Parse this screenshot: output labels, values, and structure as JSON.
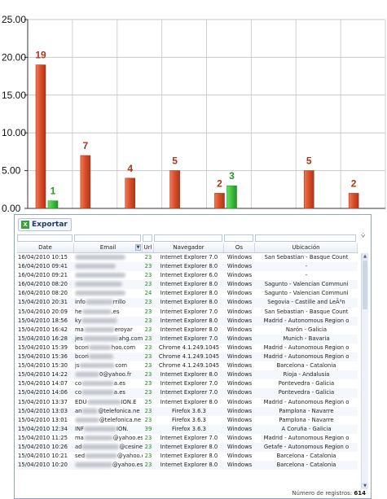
{
  "chart_data": {
    "type": "bar",
    "categories": [
      "",
      "",
      "",
      "",
      "",
      "",
      "",
      ""
    ],
    "series": [
      {
        "color": "#d84d2a",
        "values": [
          19,
          7,
          4,
          5,
          2,
          null,
          5,
          2
        ]
      },
      {
        "color": "#3cbf3c",
        "values": [
          1,
          null,
          null,
          null,
          3,
          null,
          null,
          null
        ]
      }
    ],
    "ylim": [
      0,
      25
    ],
    "ytick_labels": [
      "0.00",
      "5.00",
      "10.00",
      "15.00",
      "20.00",
      "25.00"
    ],
    "grid": true,
    "data_labels": true
  },
  "toolbar": {
    "export_label": "Exportar",
    "export_icon": "excel-icon"
  },
  "table": {
    "columns": [
      "Date",
      "Email",
      "Url",
      "Navegador",
      "Os",
      "Ubicación"
    ],
    "rows": [
      [
        "16/04/2010 10:15",
        "",
        "23",
        "Internet Explorer 7.0",
        "Windows",
        "San Sebastian - Basque Count"
      ],
      [
        "16/04/2010 09:41",
        "",
        "23",
        "Internet Explorer 8.0",
        "Windows",
        "-"
      ],
      [
        "16/04/2010 09:21",
        "",
        "23",
        "Internet Explorer 6.0",
        "Windows",
        "-"
      ],
      [
        "16/04/2010 08:20",
        "",
        "23",
        "Internet Explorer 8.0",
        "Windows",
        "Sagunto - Valencian Communi"
      ],
      [
        "16/04/2010 08:20",
        "",
        "24",
        "Internet Explorer 8.0",
        "Windows",
        "Sagunto - Valencian Communi"
      ],
      [
        "15/04/2010 20:31",
        "info",
        "23",
        "Internet Explorer 8.0",
        "Windows",
        "Segovia - Castille and LeÃ³n"
      ],
      [
        "15/04/2010 20:09",
        "he",
        "23",
        "Internet Explorer 7.0",
        "Windows",
        "San Sebastian - Basque Count"
      ],
      [
        "15/04/2010 18:56",
        "ky",
        "23",
        "Internet Explorer 8.0",
        "Windows",
        "Madrid - Autonomous Region o"
      ],
      [
        "15/04/2010 16:42",
        "ma",
        "23",
        "Internet Explorer 8.0",
        "Windows",
        "Narón - Galicia"
      ],
      [
        "15/04/2010 16:28",
        "jes",
        "23",
        "Internet Explorer 7.0",
        "Windows",
        "Munich - Bavaria"
      ],
      [
        "15/04/2010 15:39",
        "bcori",
        "23",
        "Chrome 4.1.249.1045",
        "Windows",
        "Madrid - Autonomous Region o"
      ],
      [
        "15/04/2010 15:36",
        "bcori",
        "23",
        "Chrome 4.1.249.1045",
        "Windows",
        "Madrid - Autonomous Region o"
      ],
      [
        "15/04/2010 15:30",
        "js",
        "23",
        "Chrome 4.1.249.1045",
        "Windows",
        "Barcelona - Catalonia"
      ],
      [
        "15/04/2010 14:22",
        "",
        "23",
        "Internet Explorer 8.0",
        "Windows",
        "Rioja - Andalusia"
      ],
      [
        "15/04/2010 14:07",
        "co",
        "23",
        "Internet Explorer 7.0",
        "Windows",
        "Pontevedra - Galicia"
      ],
      [
        "15/04/2010 14:06",
        "co",
        "23",
        "Internet Explorer 7.0",
        "Windows",
        "Pontevedra - Galicia"
      ],
      [
        "15/04/2010 13:37",
        "EDU",
        "25",
        "Internet Explorer 8.0",
        "Windows",
        "Madrid - Autonomous Region o"
      ],
      [
        "15/04/2010 13:03",
        "an",
        "23",
        "Firefox 3.6.3",
        "Windows",
        "Pamplona - Navarre"
      ],
      [
        "15/04/2010 13:01",
        "",
        "23",
        "Firefox 3.6.3",
        "Windows",
        "Pamplona - Navarre"
      ],
      [
        "15/04/2010 12:34",
        "INF",
        "39",
        "Firefox 3.6.3",
        "Windows",
        "A Coruña - Galicia"
      ],
      [
        "15/04/2010 11:25",
        "ma",
        "23",
        "Internet Explorer 7.0",
        "Windows",
        "Madrid - Autonomous Region o"
      ],
      [
        "15/04/2010 10:26",
        "ad",
        "23",
        "Internet Explorer 8.0",
        "Windows",
        "Getafe - Autonomous Region o"
      ],
      [
        "15/04/2010 10:21",
        "sed",
        "23",
        "Internet Explorer 8.0",
        "Windows",
        "Barcelona - Catalonia"
      ],
      [
        "15/04/2010 10:20",
        "",
        "23",
        "Internet Explorer 8.0",
        "Windows",
        "Barcelona - Catalonia"
      ]
    ],
    "email_suffixes": [
      "",
      "",
      "",
      "",
      "",
      "rrillo",
      ".es",
      "",
      "eroyar",
      "ahg.com",
      "hoo.com",
      "",
      "com",
      "0@yahoo.fr",
      "a.es",
      "a.es",
      "ION.E",
      "@telefonica.ne",
      "@telefonica.ne",
      "ION.",
      "@yahoo.es",
      "@cesine.e",
      "@yahoo.es",
      "@yahoo.es"
    ]
  },
  "footer": {
    "label": "Número de registros:",
    "count": "614"
  }
}
